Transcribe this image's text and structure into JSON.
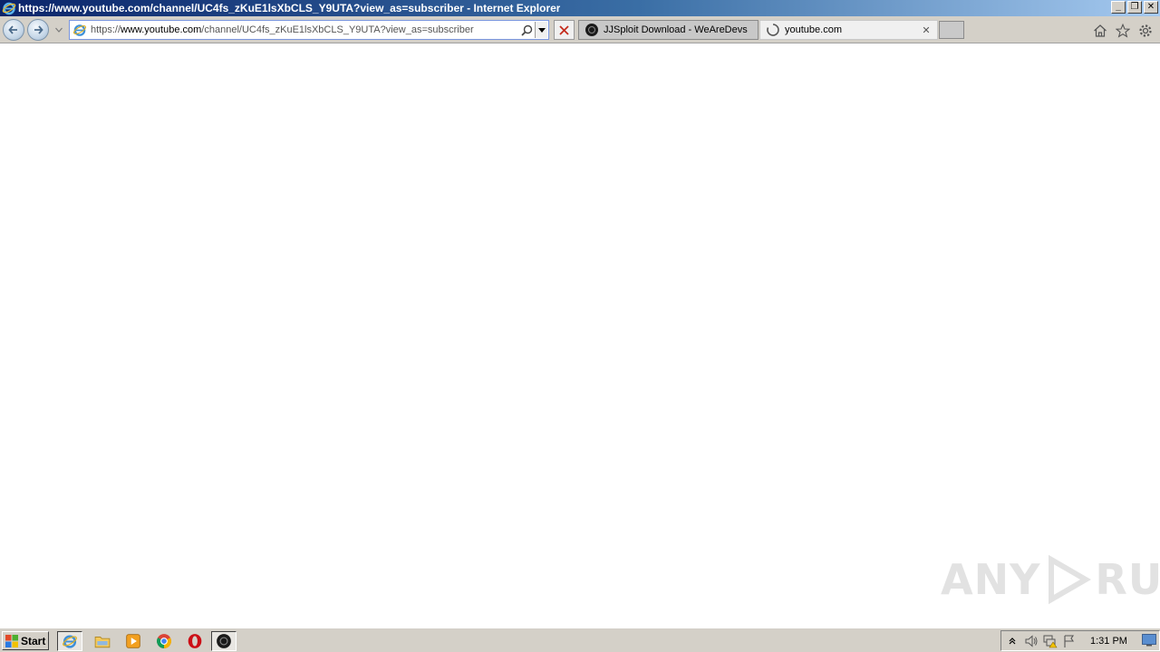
{
  "window": {
    "title": "https://www.youtube.com/channel/UC4fs_zKuE1lsXbCLS_Y9UTA?view_as=subscriber - Internet Explorer",
    "controls": {
      "minimize": "_",
      "restore": "❐",
      "close": "✕"
    }
  },
  "address_bar": {
    "scheme": "https://",
    "host": "www.youtube.com",
    "path": "/channel/UC4fs_zKuE1lsXbCLS_Y9UTA?view_as=subscriber"
  },
  "tabs": [
    {
      "label": "JJSploit Download - WeAreDevs",
      "active": false,
      "icon": "wearedevs-icon"
    },
    {
      "label": "youtube.com",
      "active": true,
      "icon": "loading-spinner-icon",
      "close": "✕"
    }
  ],
  "toolbar_icons": [
    "home-icon",
    "favorites-star-icon",
    "settings-gear-icon"
  ],
  "watermark": {
    "left": "ANY",
    "right": "RUN"
  },
  "taskbar": {
    "start_label": "Start",
    "apps": [
      "internet-explorer-icon",
      "file-explorer-icon",
      "media-player-icon",
      "chrome-icon",
      "opera-icon",
      "wearedevs-icon"
    ],
    "clock": "1:31 PM"
  },
  "colors": {
    "title_gradient_start": "#0a246a",
    "title_gradient_end": "#a6caf0",
    "chrome_gray": "#d4d0c8"
  }
}
